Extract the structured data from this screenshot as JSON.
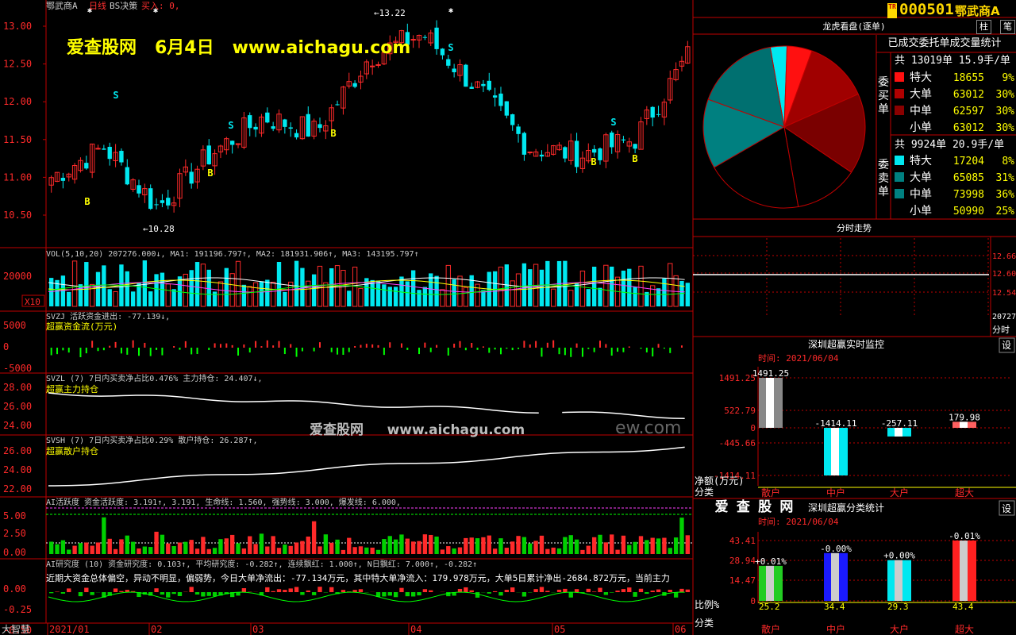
{
  "header": {
    "tr_badge": "TR",
    "stock_code": "000501",
    "stock_name": "鄂武商A",
    "main_info": "鄂武商A",
    "period": "日线",
    "strategy": "BS决策",
    "buy_signal": "买入: 0,",
    "btn_zhu": "柱",
    "btn_bi": "笔"
  },
  "watermark": {
    "banner": "爱查股网   6月4日   www.aichagu.com",
    "center": "爱查股网     www.aichagu.com",
    "center_ghost": "ew.com"
  },
  "main_panel": {
    "y_ticks": [
      "13.00",
      "12.50",
      "12.00",
      "11.50",
      "11.00",
      "10.50"
    ],
    "high_label": "13.22",
    "low_label": "10.28",
    "colors": {
      "up": "#ff2a2a",
      "down": "#00e8f0"
    }
  },
  "vol_panel": {
    "title": "VOL(5,10,20) 207276.000↓, MA1: 191196.797↑, MA2: 181931.906↑, MA3: 143195.797↑",
    "y_tick": "20000",
    "unit": "X10"
  },
  "svzj_panel": {
    "title": "SVZJ  活跃资金进出: -77.139↓,",
    "subtitle": "超赢资金流(万元)",
    "y_ticks": [
      "5000",
      "0",
      "-5000"
    ]
  },
  "svzl_panel": {
    "title": "SVZL (7) 7日内买卖净占比0.476% 主力持仓: 24.407↓,",
    "subtitle": "超赢主力持仓",
    "y_ticks": [
      "28.00",
      "26.00",
      "24.00"
    ]
  },
  "svsh_panel": {
    "title": "SVSH (7) 7日内买卖净占比0.29% 散户持仓: 26.287↑,",
    "subtitle": "超赢散户持仓",
    "y_ticks": [
      "26.00",
      "24.00",
      "22.00"
    ]
  },
  "ai_panel": {
    "title": "AI活跃度  资金活跃度: 3.191↑, 3.191, 生命线: 1.560, 强势线: 3.000, 爆发线: 6.000,",
    "y_ticks": [
      "5.00",
      "2.50",
      "0.00"
    ]
  },
  "airesearch_panel": {
    "title": "AI研究度 (10) 资金研究度: 0.103↑, 平均研究度: -0.282↑, 连续飘红: 1.000↑, N日飘红: 7.000↑, -0.282↑",
    "narrative": "近期大资金总体偏空，异动不明显，偏弱势，今日大单净流出：-77.134万元，其中特大单净流入：179.978万元，大单5日累计净出-2684.872万元，当前主力",
    "y_ticks": [
      "0.00",
      "-0.25",
      "-0.50"
    ]
  },
  "x_axis": {
    "corner": "大智慧",
    "labels": [
      "2021/01",
      "02",
      "03",
      "04",
      "05",
      "06"
    ]
  },
  "longhu": {
    "title": "龙虎看盘(逐单)",
    "stats_title": "已成交委托单成交量统计",
    "buy": {
      "label": "委买单",
      "summary": "共 13019单 15.9手/单",
      "rows": [
        {
          "name": "特大",
          "vol": "18655",
          "pct": "9%"
        },
        {
          "name": "大单",
          "vol": "63012",
          "pct": "30%"
        },
        {
          "name": "中单",
          "vol": "62597",
          "pct": "30%"
        },
        {
          "name": "小单",
          "vol": "63012",
          "pct": "30%"
        }
      ]
    },
    "sell": {
      "label": "委卖单",
      "summary": "共 9924单 20.9手/单",
      "rows": [
        {
          "name": "特大",
          "vol": "17204",
          "pct": "8%"
        },
        {
          "name": "大单",
          "vol": "65085",
          "pct": "31%"
        },
        {
          "name": "中单",
          "vol": "73998",
          "pct": "36%"
        },
        {
          "name": "小单",
          "vol": "50990",
          "pct": "25%"
        }
      ]
    }
  },
  "intraday": {
    "title": "分时走势",
    "y_ticks": [
      "12.66",
      "12.60",
      "12.54"
    ],
    "vol_value": "20727",
    "vol_label": "分时"
  },
  "monitor": {
    "title": "深圳超赢实时监控",
    "btn": "设",
    "time_label": "时间: 2021/06/04",
    "y_ticks": [
      "1491.25",
      "522.79",
      "0",
      "-445.66",
      "-1414.11"
    ],
    "y_unit": "净额(万元)",
    "x_title": "分类",
    "categories": [
      "散户",
      "中户",
      "大户",
      "超大"
    ],
    "values": [
      1491.25,
      -1414.11,
      -257.11,
      179.98
    ],
    "value_labels": [
      "1491.25",
      "-1414.11",
      "-257.11",
      "179.98"
    ]
  },
  "stats": {
    "brand": "爱 查 股 网",
    "title": "深圳超赢分类统计",
    "btn": "设",
    "time_label": "时间: 2021/06/04",
    "y_ticks": [
      "43.41",
      "28.94",
      "14.47",
      "0"
    ],
    "y_unit": "比例%",
    "x_title": "分类",
    "categories": [
      "散户",
      "中户",
      "大户",
      "超大"
    ],
    "values": [
      25.2,
      34.4,
      29.3,
      43.4
    ],
    "value_labels": [
      "25.2",
      "34.4",
      "29.3",
      "43.4"
    ],
    "change_labels": [
      "+0.01%",
      "-0.00%",
      "+0.00%",
      "-0.01%"
    ],
    "colors": [
      "#22cc22",
      "#1a1aff",
      "#00e8f0",
      "#ff2020"
    ]
  },
  "chart_data": [
    {
      "type": "bar",
      "title": "深圳超赢实时监控",
      "ylabel": "净额(万元)",
      "categories": [
        "散户",
        "中户",
        "大户",
        "超大"
      ],
      "values": [
        1491.25,
        -1414.11,
        -257.11,
        179.98
      ],
      "ylim": [
        -1414.11,
        1491.25
      ]
    },
    {
      "type": "bar",
      "title": "深圳超赢分类统计",
      "ylabel": "比例%",
      "categories": [
        "散户",
        "中户",
        "大户",
        "超大"
      ],
      "values": [
        25.2,
        34.4,
        29.3,
        43.4
      ],
      "ylim": [
        0,
        43.41
      ]
    },
    {
      "type": "pie",
      "title": "龙虎看盘(逐单)",
      "series": [
        {
          "name": "委买单",
          "categories": [
            "特大",
            "大单",
            "中单",
            "小单"
          ],
          "values": [
            18655,
            63012,
            62597,
            63012
          ]
        },
        {
          "name": "委卖单",
          "categories": [
            "特大",
            "大单",
            "中单",
            "小单"
          ],
          "values": [
            17204,
            65085,
            73998,
            50990
          ]
        }
      ]
    },
    {
      "type": "line",
      "title": "鄂武商A 日线",
      "x": [
        "2021/01",
        "02",
        "03",
        "04",
        "05",
        "06"
      ],
      "series": [
        {
          "name": "close",
          "values": [
            10.9,
            11.6,
            11.8,
            12.5,
            11.2,
            12.6
          ]
        }
      ],
      "ylim": [
        10.28,
        13.22
      ]
    }
  ]
}
